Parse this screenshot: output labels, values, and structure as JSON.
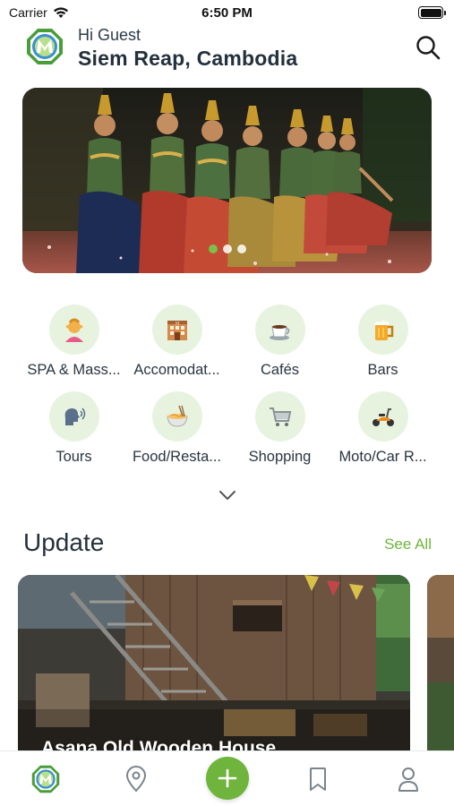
{
  "status_bar": {
    "carrier": "Carrier",
    "time": "6:50 PM"
  },
  "header": {
    "greeting": "Hi Guest",
    "location": "Siem Reap, Cambodia"
  },
  "banner": {
    "slide_count": 3,
    "active_slide": 1
  },
  "categories": [
    {
      "label": "SPA & Mass...",
      "icon": "woman-massage-icon"
    },
    {
      "label": "Accomodat...",
      "icon": "hotel-icon"
    },
    {
      "label": "Cafés",
      "icon": "coffee-icon"
    },
    {
      "label": "Bars",
      "icon": "beer-icon"
    },
    {
      "label": "Tours",
      "icon": "speaking-head-icon"
    },
    {
      "label": "Food/Resta...",
      "icon": "noodle-bowl-icon"
    },
    {
      "label": "Shopping",
      "icon": "shopping-cart-icon"
    },
    {
      "label": "Moto/Car R...",
      "icon": "scooter-icon"
    }
  ],
  "update": {
    "title": "Update",
    "see_all": "See All",
    "cards": [
      {
        "title": "Asana Old Wooden House"
      }
    ]
  },
  "tabbar": {
    "items": [
      "home-logo-icon",
      "map-pin-icon",
      "add-icon",
      "bookmark-icon",
      "profile-icon"
    ]
  },
  "colors": {
    "accent": "#6fb43c",
    "category_bg": "#e7f3df",
    "dot_active": "#7cbf4a",
    "text_dark": "#23303d"
  }
}
